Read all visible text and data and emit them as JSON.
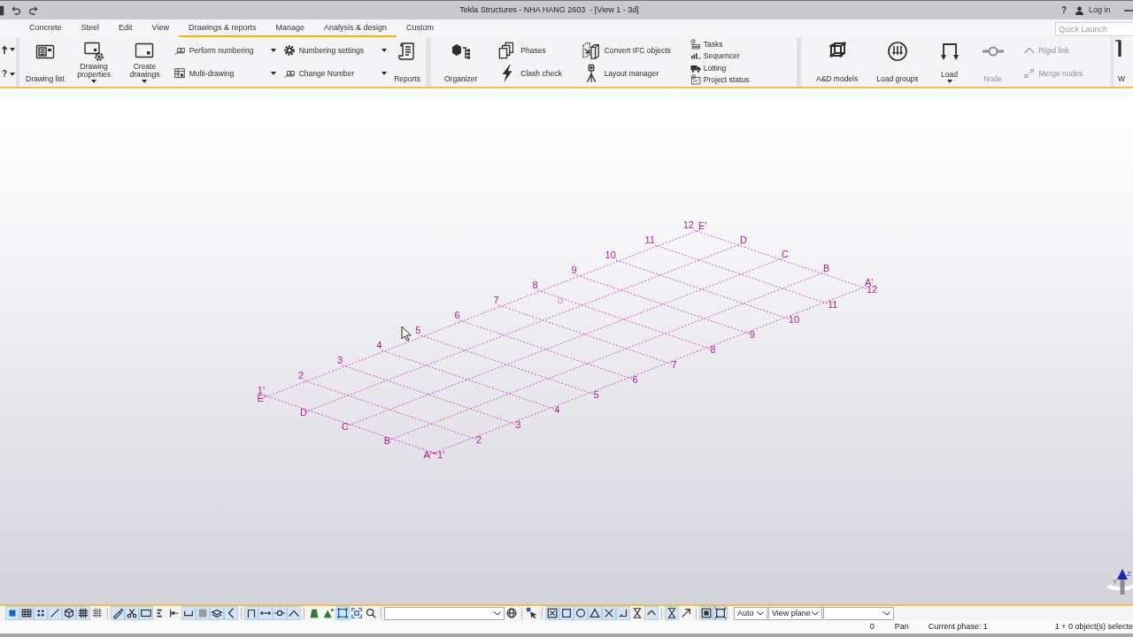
{
  "title_bar": {
    "title": "Tekla Structures - NHA HANG 2603  - [View 1 - 3d]",
    "help": "?",
    "login": "Log in"
  },
  "tabs": [
    {
      "label": "Concrete",
      "selected": false
    },
    {
      "label": "Steel",
      "selected": false
    },
    {
      "label": "Edit",
      "selected": false
    },
    {
      "label": "View",
      "selected": false
    },
    {
      "label": "Drawings & reports",
      "selected": true
    },
    {
      "label": "Manage",
      "selected": true
    },
    {
      "label": "Analysis & design",
      "selected": true
    },
    {
      "label": "Custom",
      "selected": false
    }
  ],
  "quick_launch": {
    "placeholder": "Quick Launch"
  },
  "ribbon": {
    "left_stub": [
      {
        "kind": "icon",
        "dropdown": true
      },
      {
        "kind": "text",
        "label": "?",
        "dropdown": true
      }
    ],
    "groups": [
      {
        "items": [
          {
            "kind": "large",
            "label": "Drawing list",
            "dropdown": false,
            "disabled": false
          },
          {
            "kind": "large",
            "label": "Drawing properties",
            "dropdown": true,
            "disabled": false
          },
          {
            "kind": "large",
            "label": "Create drawings",
            "dropdown": true,
            "disabled": false
          },
          {
            "kind": "column",
            "buttons": [
              {
                "label": "Perform numbering",
                "dropdown": true,
                "disabled": false
              },
              {
                "label": "Multi-drawing",
                "dropdown": true,
                "disabled": false
              }
            ]
          },
          {
            "kind": "column",
            "buttons": [
              {
                "label": "Numbering settings",
                "dropdown": true,
                "disabled": false
              },
              {
                "label": "Change Number",
                "dropdown": true,
                "disabled": false
              }
            ]
          },
          {
            "kind": "large",
            "label": "Reports",
            "dropdown": false,
            "disabled": false
          }
        ]
      },
      {
        "items": [
          {
            "kind": "large",
            "label": "Organizer",
            "dropdown": false,
            "disabled": false
          },
          {
            "kind": "column",
            "buttons": [
              {
                "label": "Phases",
                "dropdown": false,
                "disabled": false
              },
              {
                "label": "Clash check",
                "dropdown": false,
                "disabled": false
              }
            ]
          },
          {
            "kind": "column",
            "buttons": [
              {
                "label": "Convert IFC objects",
                "dropdown": false,
                "disabled": false
              },
              {
                "label": "Layout manager",
                "dropdown": false,
                "disabled": false
              }
            ]
          },
          {
            "kind": "column",
            "buttons": [
              {
                "label": "Tasks",
                "dropdown": false,
                "disabled": false
              },
              {
                "label": "Sequencer",
                "dropdown": false,
                "disabled": false
              },
              {
                "label": "Lotting",
                "dropdown": false,
                "disabled": false
              },
              {
                "label": "Project status",
                "dropdown": false,
                "disabled": false
              }
            ]
          }
        ]
      },
      {
        "items": [
          {
            "kind": "large",
            "label": "A&D models",
            "dropdown": false,
            "disabled": false
          },
          {
            "kind": "large",
            "label": "Load groups",
            "dropdown": false,
            "disabled": false
          },
          {
            "kind": "large",
            "label": "Load",
            "dropdown": true,
            "disabled": false
          },
          {
            "kind": "large",
            "label": "Node",
            "dropdown": false,
            "disabled": true
          },
          {
            "kind": "column",
            "buttons": [
              {
                "label": "Rigid link",
                "dropdown": false,
                "disabled": true
              },
              {
                "label": "Merge nodes",
                "dropdown": false,
                "disabled": true
              }
            ]
          }
        ]
      },
      {
        "items": [
          {
            "kind": "large",
            "label": "W",
            "dropdown": false,
            "disabled": false
          }
        ]
      }
    ]
  },
  "viewport": {
    "grid": {
      "number_lines": [
        {
          "top_label": "1'",
          "bottom_label": "1'"
        },
        {
          "top_label": "2",
          "bottom_label": "2"
        },
        {
          "top_label": "3",
          "bottom_label": "3"
        },
        {
          "top_label": "4",
          "bottom_label": "4"
        },
        {
          "top_label": "5",
          "bottom_label": "5"
        },
        {
          "top_label": "6",
          "bottom_label": "6"
        },
        {
          "top_label": "7",
          "bottom_label": "7"
        },
        {
          "top_label": "8",
          "bottom_label": "8"
        },
        {
          "top_label": "9",
          "bottom_label": "9"
        },
        {
          "top_label": "10",
          "bottom_label": "10"
        },
        {
          "top_label": "11",
          "bottom_label": "11"
        },
        {
          "top_label": "12",
          "bottom_label": "12"
        }
      ],
      "letter_lines": [
        {
          "left_label": "A'",
          "right_label": "A'"
        },
        {
          "left_label": "B",
          "right_label": "B"
        },
        {
          "left_label": "C",
          "right_label": "C"
        },
        {
          "left_label": "D",
          "right_label": "D"
        },
        {
          "left_label": "E'",
          "right_label": "E'"
        }
      ]
    },
    "axes": {
      "z_label": "Z",
      "y_label": "Y"
    }
  },
  "snap_toolbar": {
    "groups": [
      {
        "items": [
          {
            "kind": "button",
            "selected": true
          },
          {
            "kind": "button",
            "selected": true
          },
          {
            "kind": "button",
            "selected": true
          },
          {
            "kind": "button",
            "selected": true
          },
          {
            "kind": "button",
            "selected": true
          },
          {
            "kind": "button",
            "selected": true
          },
          {
            "kind": "button",
            "selected": false
          }
        ]
      },
      {
        "items": [
          {
            "kind": "button",
            "selected": true
          },
          {
            "kind": "button",
            "selected": true
          },
          {
            "kind": "button",
            "selected": true
          },
          {
            "kind": "button",
            "selected": false
          },
          {
            "kind": "button",
            "selected": false
          },
          {
            "kind": "button",
            "selected": true
          },
          {
            "kind": "button",
            "selected": true
          },
          {
            "kind": "button",
            "selected": true
          },
          {
            "kind": "button",
            "selected": true
          }
        ]
      },
      {
        "items": [
          {
            "kind": "button",
            "selected": true
          },
          {
            "kind": "button",
            "selected": true
          },
          {
            "kind": "button",
            "selected": true
          },
          {
            "kind": "button",
            "selected": true
          }
        ]
      },
      {
        "items": [
          {
            "kind": "button",
            "selected": false
          },
          {
            "kind": "button",
            "selected": false
          },
          {
            "kind": "button",
            "selected": true
          },
          {
            "kind": "button",
            "selected": false
          },
          {
            "kind": "button",
            "selected": false
          }
        ]
      },
      {
        "items": [
          {
            "kind": "dropdown"
          },
          {
            "kind": "button",
            "selected": false
          }
        ]
      },
      {
        "items": [
          {
            "kind": "button",
            "selected": false
          }
        ]
      },
      {
        "items": [
          {
            "kind": "button",
            "selected": true
          },
          {
            "kind": "button",
            "selected": true
          },
          {
            "kind": "button",
            "selected": true
          },
          {
            "kind": "button",
            "selected": true
          },
          {
            "kind": "button",
            "selected": true
          },
          {
            "kind": "button",
            "selected": true
          },
          {
            "kind": "button",
            "selected": false
          },
          {
            "kind": "button",
            "selected": true
          }
        ]
      },
      {
        "items": [
          {
            "kind": "button",
            "selected": true
          },
          {
            "kind": "button",
            "selected": false
          }
        ]
      },
      {
        "items": [
          {
            "kind": "button",
            "selected": true
          },
          {
            "kind": "button",
            "selected": true
          },
          {
            "kind": "dropdown",
            "value": "Auto"
          },
          {
            "kind": "dropdown",
            "value": "View plane"
          },
          {
            "kind": "dropdown"
          }
        ]
      }
    ]
  },
  "status_bar": {
    "fields": [
      "0",
      "Pan",
      "Current phase: 1",
      "1 + 0 object(s) selecte"
    ]
  }
}
